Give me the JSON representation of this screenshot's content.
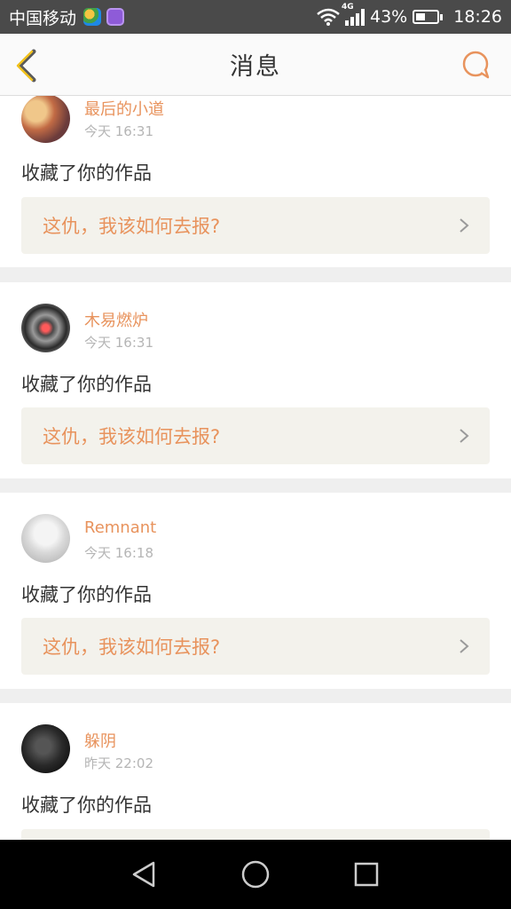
{
  "status_bar": {
    "carrier": "中国移动",
    "network": "4G",
    "battery": "43%",
    "battery_level": 0.43,
    "time": "18:26"
  },
  "header": {
    "title": "消息",
    "back_icon": "chevron-left-icon",
    "right_icon": "chat-bubble-icon"
  },
  "messages": [
    {
      "user": "最后的小道",
      "time": "今天 16:31",
      "action": "收藏了你的作品",
      "work_title": "这仇，我该如何去报?"
    },
    {
      "user": "木易燃炉",
      "time": "今天 16:31",
      "action": "收藏了你的作品",
      "work_title": "这仇，我该如何去报?"
    },
    {
      "user": "Remnant",
      "time": "今天 16:18",
      "action": "收藏了你的作品",
      "work_title": "这仇，我该如何去报?"
    },
    {
      "user": "躲阴",
      "time": "昨天 22:02",
      "action": "收藏了你的作品",
      "work_title": ""
    }
  ],
  "colors": {
    "accent": "#e8935d",
    "status_bar_bg": "#4a4a4a",
    "work_card_bg": "#f3f2ec",
    "separator_bg": "#efefef"
  }
}
